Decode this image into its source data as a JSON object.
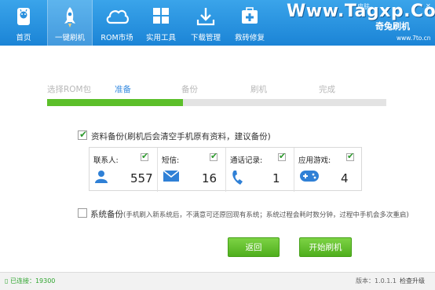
{
  "header": {
    "tabs": [
      {
        "label": "首页",
        "icon": "android-home-icon"
      },
      {
        "label": "一键刷机",
        "icon": "rocket-icon"
      },
      {
        "label": "ROM市场",
        "icon": "cloud-icon"
      },
      {
        "label": "实用工具",
        "icon": "grid-tools-icon"
      },
      {
        "label": "下载管理",
        "icon": "download-icon"
      },
      {
        "label": "救砖修复",
        "icon": "first-aid-icon"
      }
    ],
    "watermark": "Www.Tagxp.Com",
    "brand": "奇兔刷机",
    "brand_url": "www.7to.cn",
    "window_skin": "皮肤"
  },
  "steps": {
    "items": [
      "选择ROM包",
      "准备",
      "备份",
      "刷机",
      "完成"
    ],
    "current_index": 1,
    "progress": 0.4
  },
  "backup": {
    "checked": true,
    "label": "资料备份",
    "note": "(刷机后会清空手机原有资料，建议备份)",
    "items": [
      {
        "label": "联系人:",
        "count": "557",
        "checked": true,
        "icon": "contact-person-icon"
      },
      {
        "label": "短信:",
        "count": "16",
        "checked": true,
        "icon": "sms-envelope-icon"
      },
      {
        "label": "通话记录:",
        "count": "1",
        "checked": true,
        "icon": "phone-handset-icon"
      },
      {
        "label": "应用游戏:",
        "count": "4",
        "checked": true,
        "icon": "gamepad-icon"
      }
    ]
  },
  "system_backup": {
    "checked": false,
    "label": "系统备份",
    "note": "(手机刷入新系统后，不满意可还原回现有系统；系统过程会耗时数分钟，过程中手机会多次重启)"
  },
  "buttons": {
    "back": "返回",
    "start": "开始刷机"
  },
  "footer": {
    "connection": "已连接：19300",
    "version": "版本：1.0.1.1",
    "update": "检查升级"
  },
  "colors": {
    "header_top": "#3aa4ea",
    "header_bottom": "#1b84d6",
    "progress": "#5cbf2a",
    "current_step": "#3a8de0",
    "button": "#5cbf2a"
  }
}
